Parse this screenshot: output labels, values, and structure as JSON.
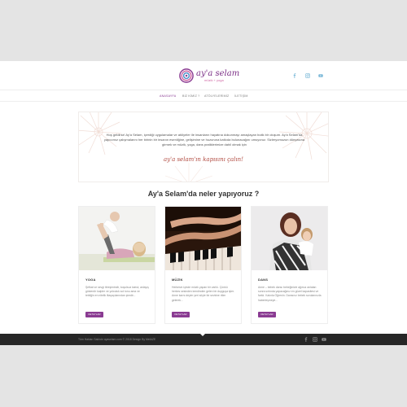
{
  "brand": {
    "name": "ay'a selam",
    "tagline": "müzik + yoga",
    "colors": {
      "primary": "#8a3b92",
      "accent": "#d06aa6",
      "slogan": "#b0483e",
      "social": "#7ab8d8"
    }
  },
  "header": {
    "social": [
      {
        "icon": "facebook-icon"
      },
      {
        "icon": "instagram-icon"
      },
      {
        "icon": "youtube-icon"
      }
    ]
  },
  "nav": {
    "items": [
      {
        "label": "ANASAYFA"
      },
      {
        "label": "BİZ KİMİZ ?"
      },
      {
        "label": "ATÖLYELERİMİZ"
      },
      {
        "label": "İLETİŞİM"
      }
    ]
  },
  "intro": {
    "text": "Hoş geldiniz! Ay'a Selam, içerdiği uygulamalar ve atölyeler ile insanların hayatına dokunmayı amaçlayan butik bir oluşum. Ay'a Selam'da yapıcımız çalışmalarını her birinin bir insanın esenliğine, gelişimine ve huzuruna katkıda bulunacağını umuyoruz. Sizleryomuzun dünyasına girmek ve müzik, yoga, dans pratiklerimize dahil olmak için",
    "slogan": "ay'a selam'ın kapısını çalın!"
  },
  "section": {
    "title_highlight": "Ay'a Selam'da",
    "title_rest": " neler yapıyoruz ?"
  },
  "cards": [
    {
      "title": "YOGA",
      "text": "Şefkat ve sevgi titreşimindir, koşulsuz kabul, anlayış gösterdir kalpler ve yolculuk sol tonu ama ve tebliğin en nitelik iltaçaçılarından şimdir...",
      "button": "DETAYLAR"
    },
    {
      "title": "MÜZİK",
      "text": "Herkesin içinde müzik yapan bir varlık. Çünkü herkes sesinden kendinden gelen bir duyguya işler. Anne karnı deyim yeri söyle bir sevkine ritim gelerek...",
      "button": "DETAYLAR"
    },
    {
      "title": "DANS",
      "text": "Anne – bebek dansı bebeğinizle ağırsız anlatan sonra sırtında yapacağınız en güzel kapasitesi ve farklı. Kalınla Öğrenin. Dansınız bebek sorularınızla haberleşmeye...",
      "button": "DETAYLAR"
    }
  ],
  "footer": {
    "text": "Tüm Hakları Saklıdır ayaselam.com © 2018 Design By MetAZE",
    "social": [
      {
        "icon": "facebook-icon"
      },
      {
        "icon": "instagram-icon"
      },
      {
        "icon": "youtube-icon"
      }
    ]
  }
}
